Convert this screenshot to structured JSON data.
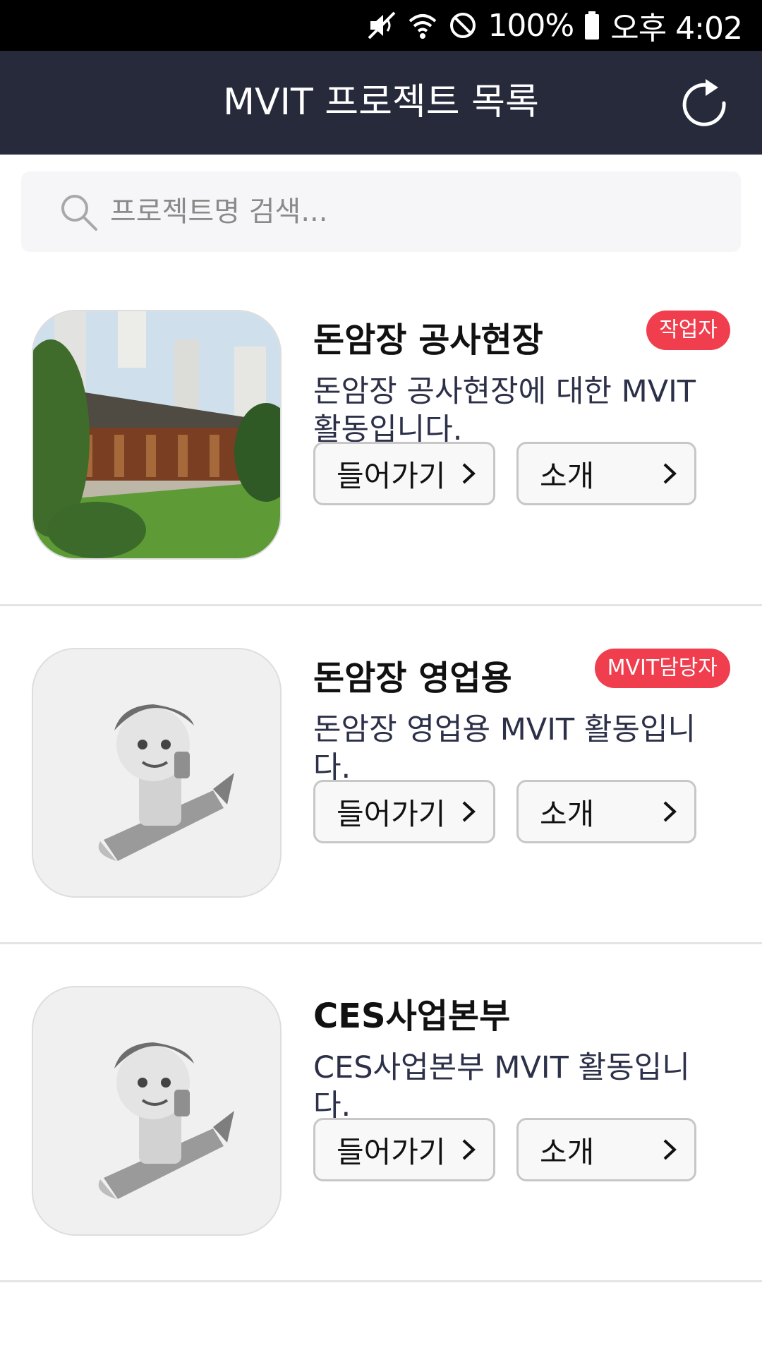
{
  "status_bar": {
    "battery": "100%",
    "time": "오후 4:02",
    "icons": [
      "mute-icon",
      "wifi-icon",
      "block-icon",
      "battery-icon"
    ]
  },
  "header": {
    "title": "MVIT 프로젝트 목록",
    "refresh_icon": "refresh-icon"
  },
  "search": {
    "placeholder": "프로젝트명 검색..."
  },
  "projects": [
    {
      "name": "돈암장 공사현장",
      "badge": "작업자",
      "description": "돈암장 공사현장에 대한 MVIT 활동입니다.",
      "thumbnail": "hanok-building-photo",
      "enter_label": "들어가기",
      "intro_label": "소개"
    },
    {
      "name": "돈암장 영업용",
      "badge": "MVIT담당자",
      "description": "돈암장 영업용 MVIT 활동입니다.",
      "thumbnail": "default-mascot-image",
      "enter_label": "들어가기",
      "intro_label": "소개"
    },
    {
      "name": "CES사업본부",
      "description": "CES사업본부 MVIT 활동입니다.",
      "thumbnail": "default-mascot-image",
      "enter_label": "들어가기",
      "intro_label": "소개"
    }
  ],
  "colors": {
    "header_bg": "#262a3b",
    "badge": "#f03e4e",
    "description_text": "#2c3048"
  }
}
